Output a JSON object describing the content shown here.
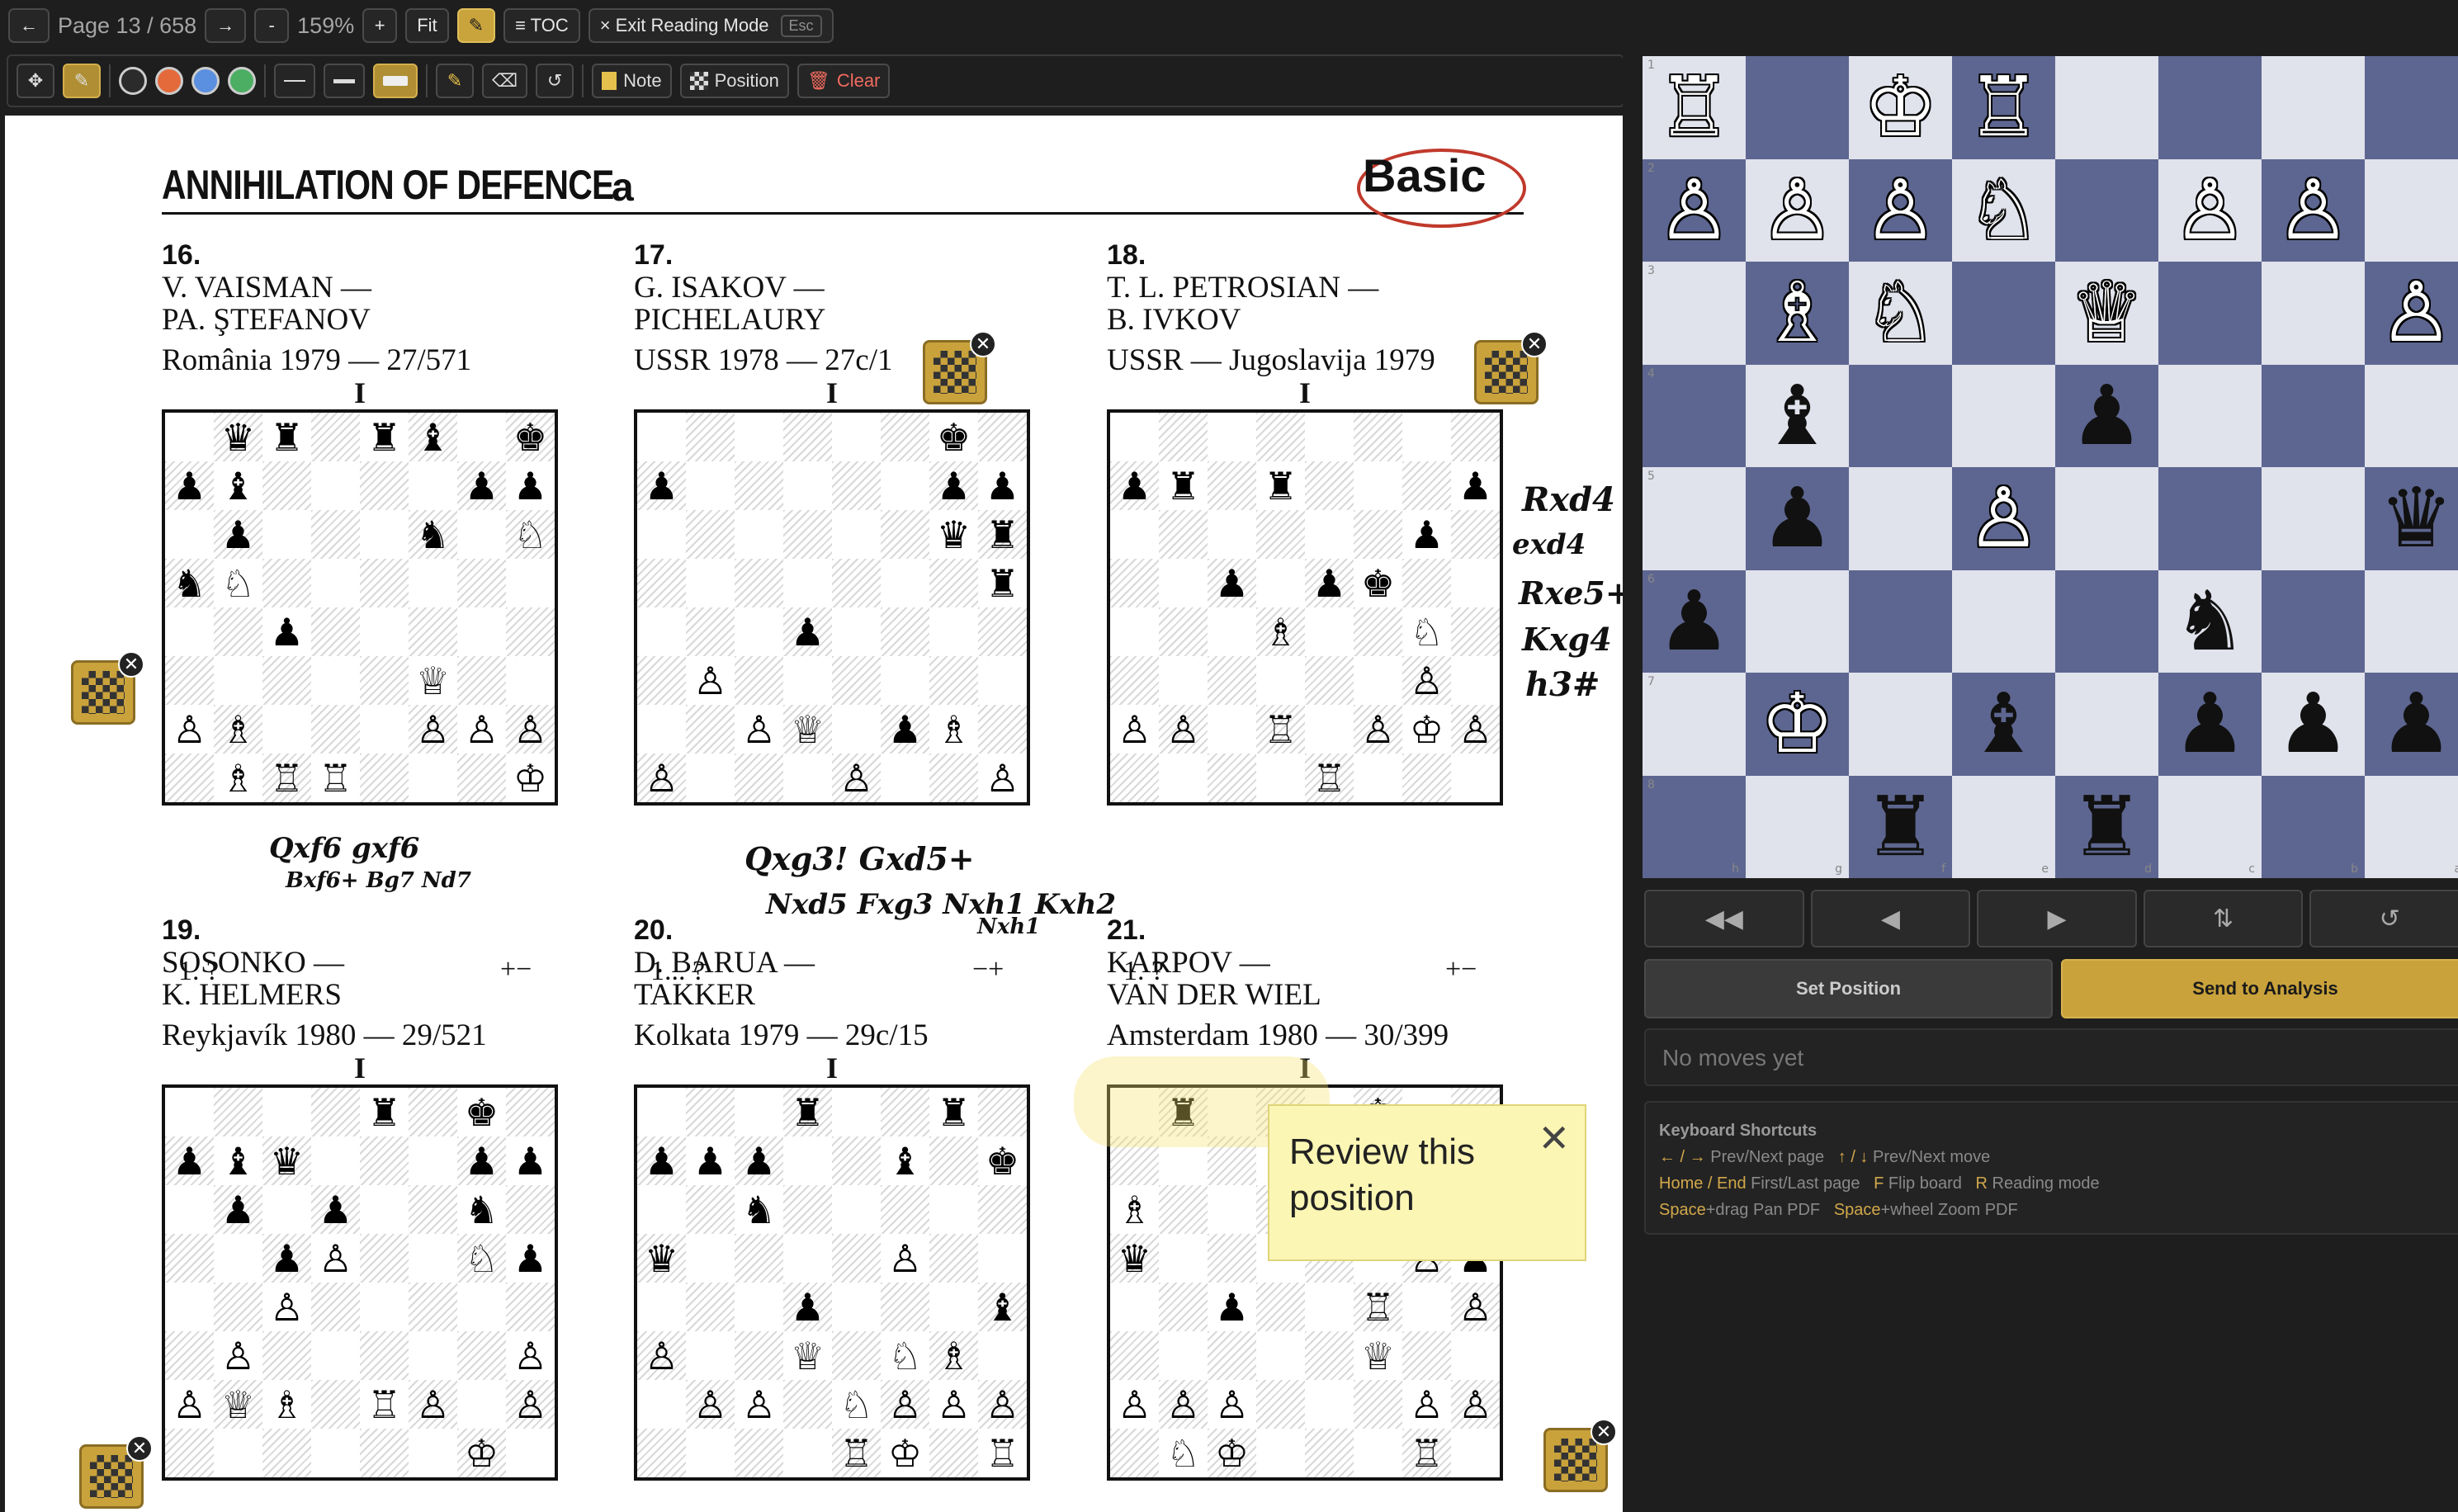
{
  "topbar": {
    "back_icon": "←",
    "page": "Page 13 / 658",
    "next_icon": "→",
    "zoom_out": "-",
    "zoom": "159%",
    "zoom_in": "+",
    "fit": "Fit",
    "pencil_icon": "✎",
    "toc": "≡ TOC",
    "exit": "× Exit Reading Mode",
    "exit_key": "Esc"
  },
  "toolbar": {
    "move_icon": "✥",
    "pen_icon": "✎",
    "colors": [
      "#2b2b2b",
      "#e46a3c",
      "#5b8fe0",
      "#4cae63"
    ],
    "eraser_icon": "⌫",
    "undo_icon": "↺",
    "note": "Note",
    "position": "Position",
    "clear": "Clear"
  },
  "pdf": {
    "title": "ANNIHILATION OF DEFENCE",
    "title_letter": "a",
    "level": "Basic",
    "problems": [
      {
        "num": "16.",
        "white": "V. VAISMAN —",
        "black": "PA. ŞTEFANOV",
        "event": "România 1979 — 27/571",
        "mark": "I",
        "prompt": "1. ?",
        "result": "+−",
        "fen": "1qr1rb1k/pb4pp/1p3n1N/nN6/2p5/5Q2/PB3PPP/1BRR3K"
      },
      {
        "num": "17.",
        "white": "G. ISAKOV —",
        "black": "PICHELAURY",
        "event": "USSR 1978 — 27c/1",
        "mark": "I",
        "prompt": "1... ?",
        "result": "−+",
        "fen": "6k1/p5pp/6qr/7r/3p4/1P6/2PQ1pB1/P3P2P/4R1RK"
      },
      {
        "num": "18.",
        "white": "T. L. PETROSIAN —",
        "black": "B. IVKOV",
        "event": "USSR — Jugoslavija 1979",
        "mark": "I",
        "prompt": "1. ?",
        "result": "+−",
        "fen": "8/pr1r3p/6p1/2p1pk2/3B2N1/6P1/PP1R1PKP/4R3"
      },
      {
        "num": "19.",
        "white": "SOSONKO —",
        "black": "K. HELMERS",
        "event": "Reykjavík 1980 — 29/521",
        "mark": "I",
        "fen": "4r1k1/pbq3pp/1p1p2n1/2pP2Np/2P5/1P5P/PQB1RP1P/6K1"
      },
      {
        "num": "20.",
        "white": "D. BARUA —",
        "black": "TAKKER",
        "event": "Kolkata 1979 — 29c/15",
        "mark": "I",
        "fen": "3r2r1/ppp2b1k/2n6p/q4P2/3p3b/P2Q1NB1/1PP1NPPP/4RK1R"
      },
      {
        "num": "21.",
        "white": "KARPOV —",
        "black": "VAN DER WIEL",
        "event": "Amsterdam 1980 — 30/399",
        "mark": "I",
        "fen": "1r3k2/4P1pb/B2pb3/q5Pp/2p2R1P/5Q2/PPP3PP/1NK3R1"
      }
    ],
    "scribbles": [
      "Qxf6 gxf6",
      "Bxf6+ Bg7 Nd7",
      "Qxg3! Gxd5+",
      "Nxd5 Fxg3 Nxh1 Kxh2",
      "Nxh1",
      "Rxd4",
      "exd4",
      "Rxe5+",
      "Kxg4",
      "h3#"
    ],
    "note_text": "Review this position",
    "note_close": "✕",
    "chip_close": "✕"
  },
  "board": {
    "rank_labels": [
      "1",
      "2",
      "3",
      "4",
      "5",
      "6",
      "7",
      "8"
    ],
    "file_labels": [
      "h",
      "g",
      "f",
      "e",
      "d",
      "c",
      "b",
      "a"
    ],
    "rows": [
      [
        "wR",
        "",
        "wK",
        "wR",
        "",
        "",
        "",
        ""
      ],
      [
        "wP",
        "wP",
        "wP",
        "wN",
        "",
        "wP",
        "wP",
        ""
      ],
      [
        "",
        "wB",
        "wN",
        "",
        "wQ",
        "",
        "",
        "wP"
      ],
      [
        "",
        "bB",
        "",
        "",
        "bP",
        "",
        "",
        ""
      ],
      [
        "",
        "bP",
        "",
        "wP",
        "",
        "",
        "",
        "bQ"
      ],
      [
        "bP",
        "",
        "",
        "",
        "",
        "bN",
        "",
        ""
      ],
      [
        "",
        "wK",
        "",
        "bB",
        "",
        "bP",
        "bP",
        "bP"
      ],
      [
        "",
        "",
        "bR",
        "",
        "bR",
        "",
        "",
        ""
      ]
    ]
  },
  "controls": {
    "first": "◀◀",
    "prev": "◀",
    "next": "▶",
    "flip": "⇅",
    "reset": "↺",
    "set_position": "Set Position",
    "send_to_analysis": "Send to Analysis",
    "moves_placeholder": "No moves yet"
  },
  "shortcuts": {
    "title": "Keyboard Shortcuts",
    "line1": [
      {
        "k": "← / →",
        "t": "Prev/Next page"
      },
      {
        "k": "↑ / ↓",
        "t": "Prev/Next move"
      }
    ],
    "line2": [
      {
        "k": "Home / End",
        "t": "First/Last page"
      },
      {
        "k": "F",
        "t": "Flip board"
      },
      {
        "k": "R",
        "t": "Reading mode"
      }
    ],
    "line3": [
      {
        "k": "Space",
        "t": "+drag Pan PDF"
      },
      {
        "k": "Space",
        "t": "+wheel Zoom PDF"
      }
    ]
  }
}
